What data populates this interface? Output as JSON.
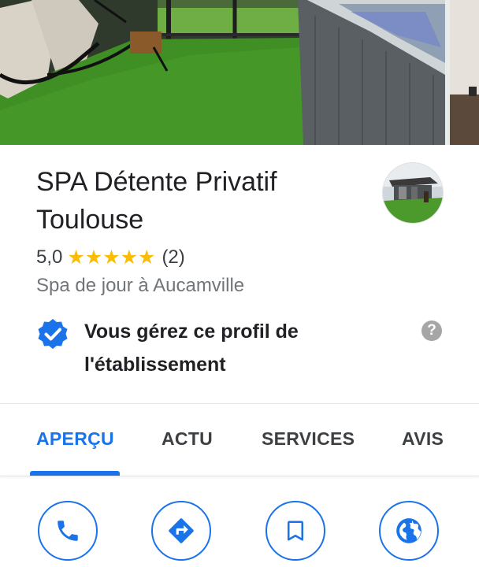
{
  "place": {
    "name": "SPA Détente Privatif Toulouse",
    "rating": "5,0",
    "stars": "★★★★★",
    "review_count": "(2)",
    "category": "Spa de jour à Aucamville"
  },
  "verification": {
    "text": "Vous gérez ce profil de l'établissement",
    "help": "?"
  },
  "tabs": [
    {
      "label": "APERÇU",
      "active": true
    },
    {
      "label": "ACTU"
    },
    {
      "label": "SERVICES"
    },
    {
      "label": "AVIS"
    }
  ],
  "actions": [
    "phone-icon",
    "directions-icon",
    "save-bookmark-icon",
    "website-globe-icon"
  ],
  "colors": {
    "accent": "#1a73e8",
    "star": "#fbbc04",
    "text_primary": "#202124",
    "text_secondary": "#70757a",
    "lawn": "#3f8f24"
  }
}
